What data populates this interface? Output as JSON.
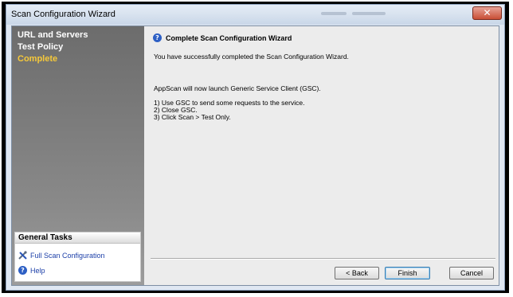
{
  "window": {
    "title": "Scan Configuration Wizard",
    "close_glyph": "✕"
  },
  "sidebar": {
    "steps": [
      {
        "label": "URL and Servers",
        "state": "done"
      },
      {
        "label": "Test Policy",
        "state": "done"
      },
      {
        "label": "Complete",
        "state": "current"
      }
    ],
    "general_tasks": {
      "header": "General Tasks",
      "items": [
        {
          "label": "Full Scan Configuration",
          "icon": "tools-icon"
        },
        {
          "label": "Help",
          "icon": "help-icon"
        }
      ]
    }
  },
  "content": {
    "title": "Complete Scan Configuration Wizard",
    "title_icon": "help-icon",
    "message": "You have successfully completed the Scan Configuration Wizard.",
    "launch_text": "AppScan will now launch Generic Service Client (GSC).",
    "steps": [
      "1) Use GSC to send some requests to the service.",
      "2) Close GSC.",
      "3) Click Scan > Test Only."
    ]
  },
  "buttons": {
    "back": "< Back",
    "finish": "Finish",
    "cancel": "Cancel"
  },
  "colors": {
    "current_step": "#f6c93a",
    "link": "#1c3fa8",
    "close": "#c84e35"
  }
}
